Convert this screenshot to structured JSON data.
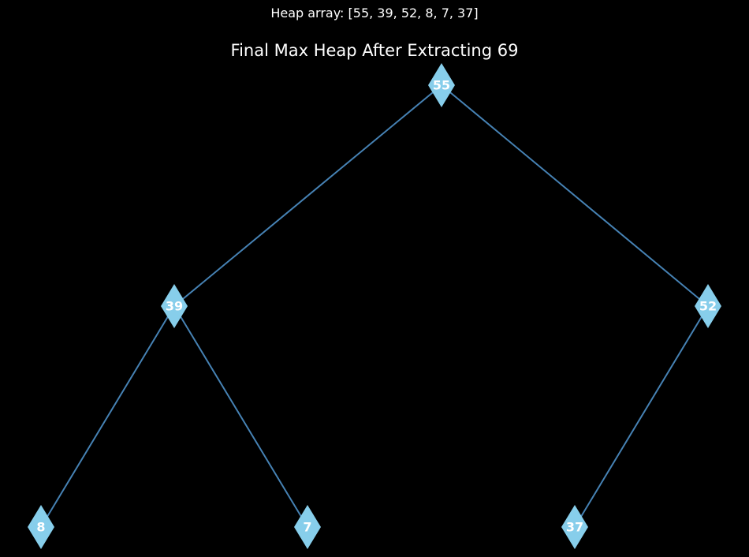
{
  "caption": "Heap array: [55, 39, 52, 8, 7, 37]",
  "title": "Final Max Heap After Extracting 69",
  "colors": {
    "background": "#000000",
    "node_fill": "#87ceeb",
    "edge": "#4682b4",
    "text": "#ffffff"
  },
  "heap": [
    55,
    39,
    52,
    8,
    7,
    37
  ],
  "nodes": [
    {
      "id": "n0",
      "label": "55"
    },
    {
      "id": "n1",
      "label": "39"
    },
    {
      "id": "n2",
      "label": "52"
    },
    {
      "id": "n3",
      "label": "8"
    },
    {
      "id": "n4",
      "label": "7"
    },
    {
      "id": "n5",
      "label": "37"
    }
  ],
  "edges": [
    {
      "from": "n0",
      "to": "n1"
    },
    {
      "from": "n0",
      "to": "n2"
    },
    {
      "from": "n1",
      "to": "n3"
    },
    {
      "from": "n1",
      "to": "n4"
    },
    {
      "from": "n2",
      "to": "n5"
    }
  ]
}
